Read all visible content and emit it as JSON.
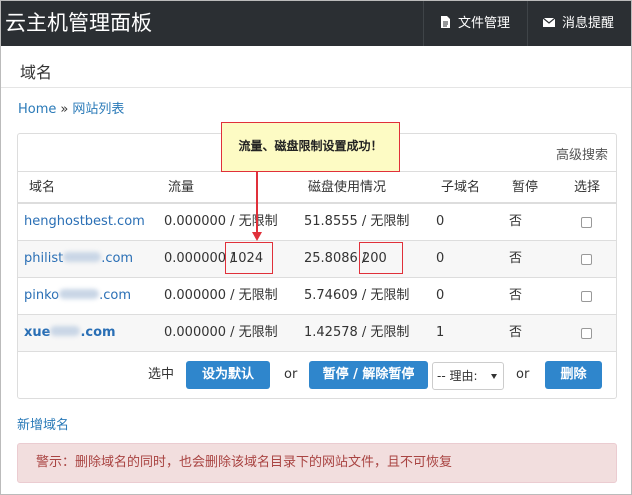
{
  "app": {
    "title": "云主机管理面板"
  },
  "nav": {
    "files": "文件管理",
    "messages": "消息提醒"
  },
  "page": {
    "title": "域名"
  },
  "breadcrumb": {
    "home": "Home",
    "sep": "»",
    "current": "网站列表"
  },
  "advanced_search": "高级搜索",
  "table": {
    "headers": [
      "域名",
      "流量",
      "磁盘使用情况",
      "子域名",
      "暂停",
      "选择"
    ],
    "rows": [
      {
        "prefix": "henghostbest.com",
        "suffix": "",
        "traffic": "0.000000 / 无限制",
        "disk": "51.8555 / 无限制",
        "sub": "0",
        "paused": "否"
      },
      {
        "prefix": "philist",
        "suffix": ".com",
        "traffic_used": "0.000000 /",
        "traffic_limit": "1024",
        "disk_used": "25.8086 /",
        "disk_limit": "200",
        "sub": "0",
        "paused": "否"
      },
      {
        "prefix": "pinko",
        "suffix": ".com",
        "traffic": "0.000000 / 无限制",
        "disk": "5.74609 / 无限制",
        "sub": "0",
        "paused": "否"
      },
      {
        "prefix": "xue",
        "suffix": ".com",
        "traffic": "0.000000 / 无限制",
        "disk": "1.42578 / 无限制",
        "sub": "1",
        "paused": "否"
      }
    ]
  },
  "actions": {
    "selected_label": "选中",
    "set_default": "设为默认",
    "or1": "or",
    "suspend": "暂停 / 解除暂停",
    "reason": "-- 理由:",
    "or2": "or",
    "delete": "删除"
  },
  "add_domain": "新增域名",
  "alert": "警示：删除域名的同时，也会删除该域名目录下的网站文件，且不可恢复",
  "callout": "流量、磁盘限制设置成功！",
  "colors": {
    "navbar": "#2b2f33",
    "primary": "#2f86cc",
    "link": "#2a7ab8",
    "danger": "#e0303a",
    "alert_bg": "#f2dede"
  }
}
